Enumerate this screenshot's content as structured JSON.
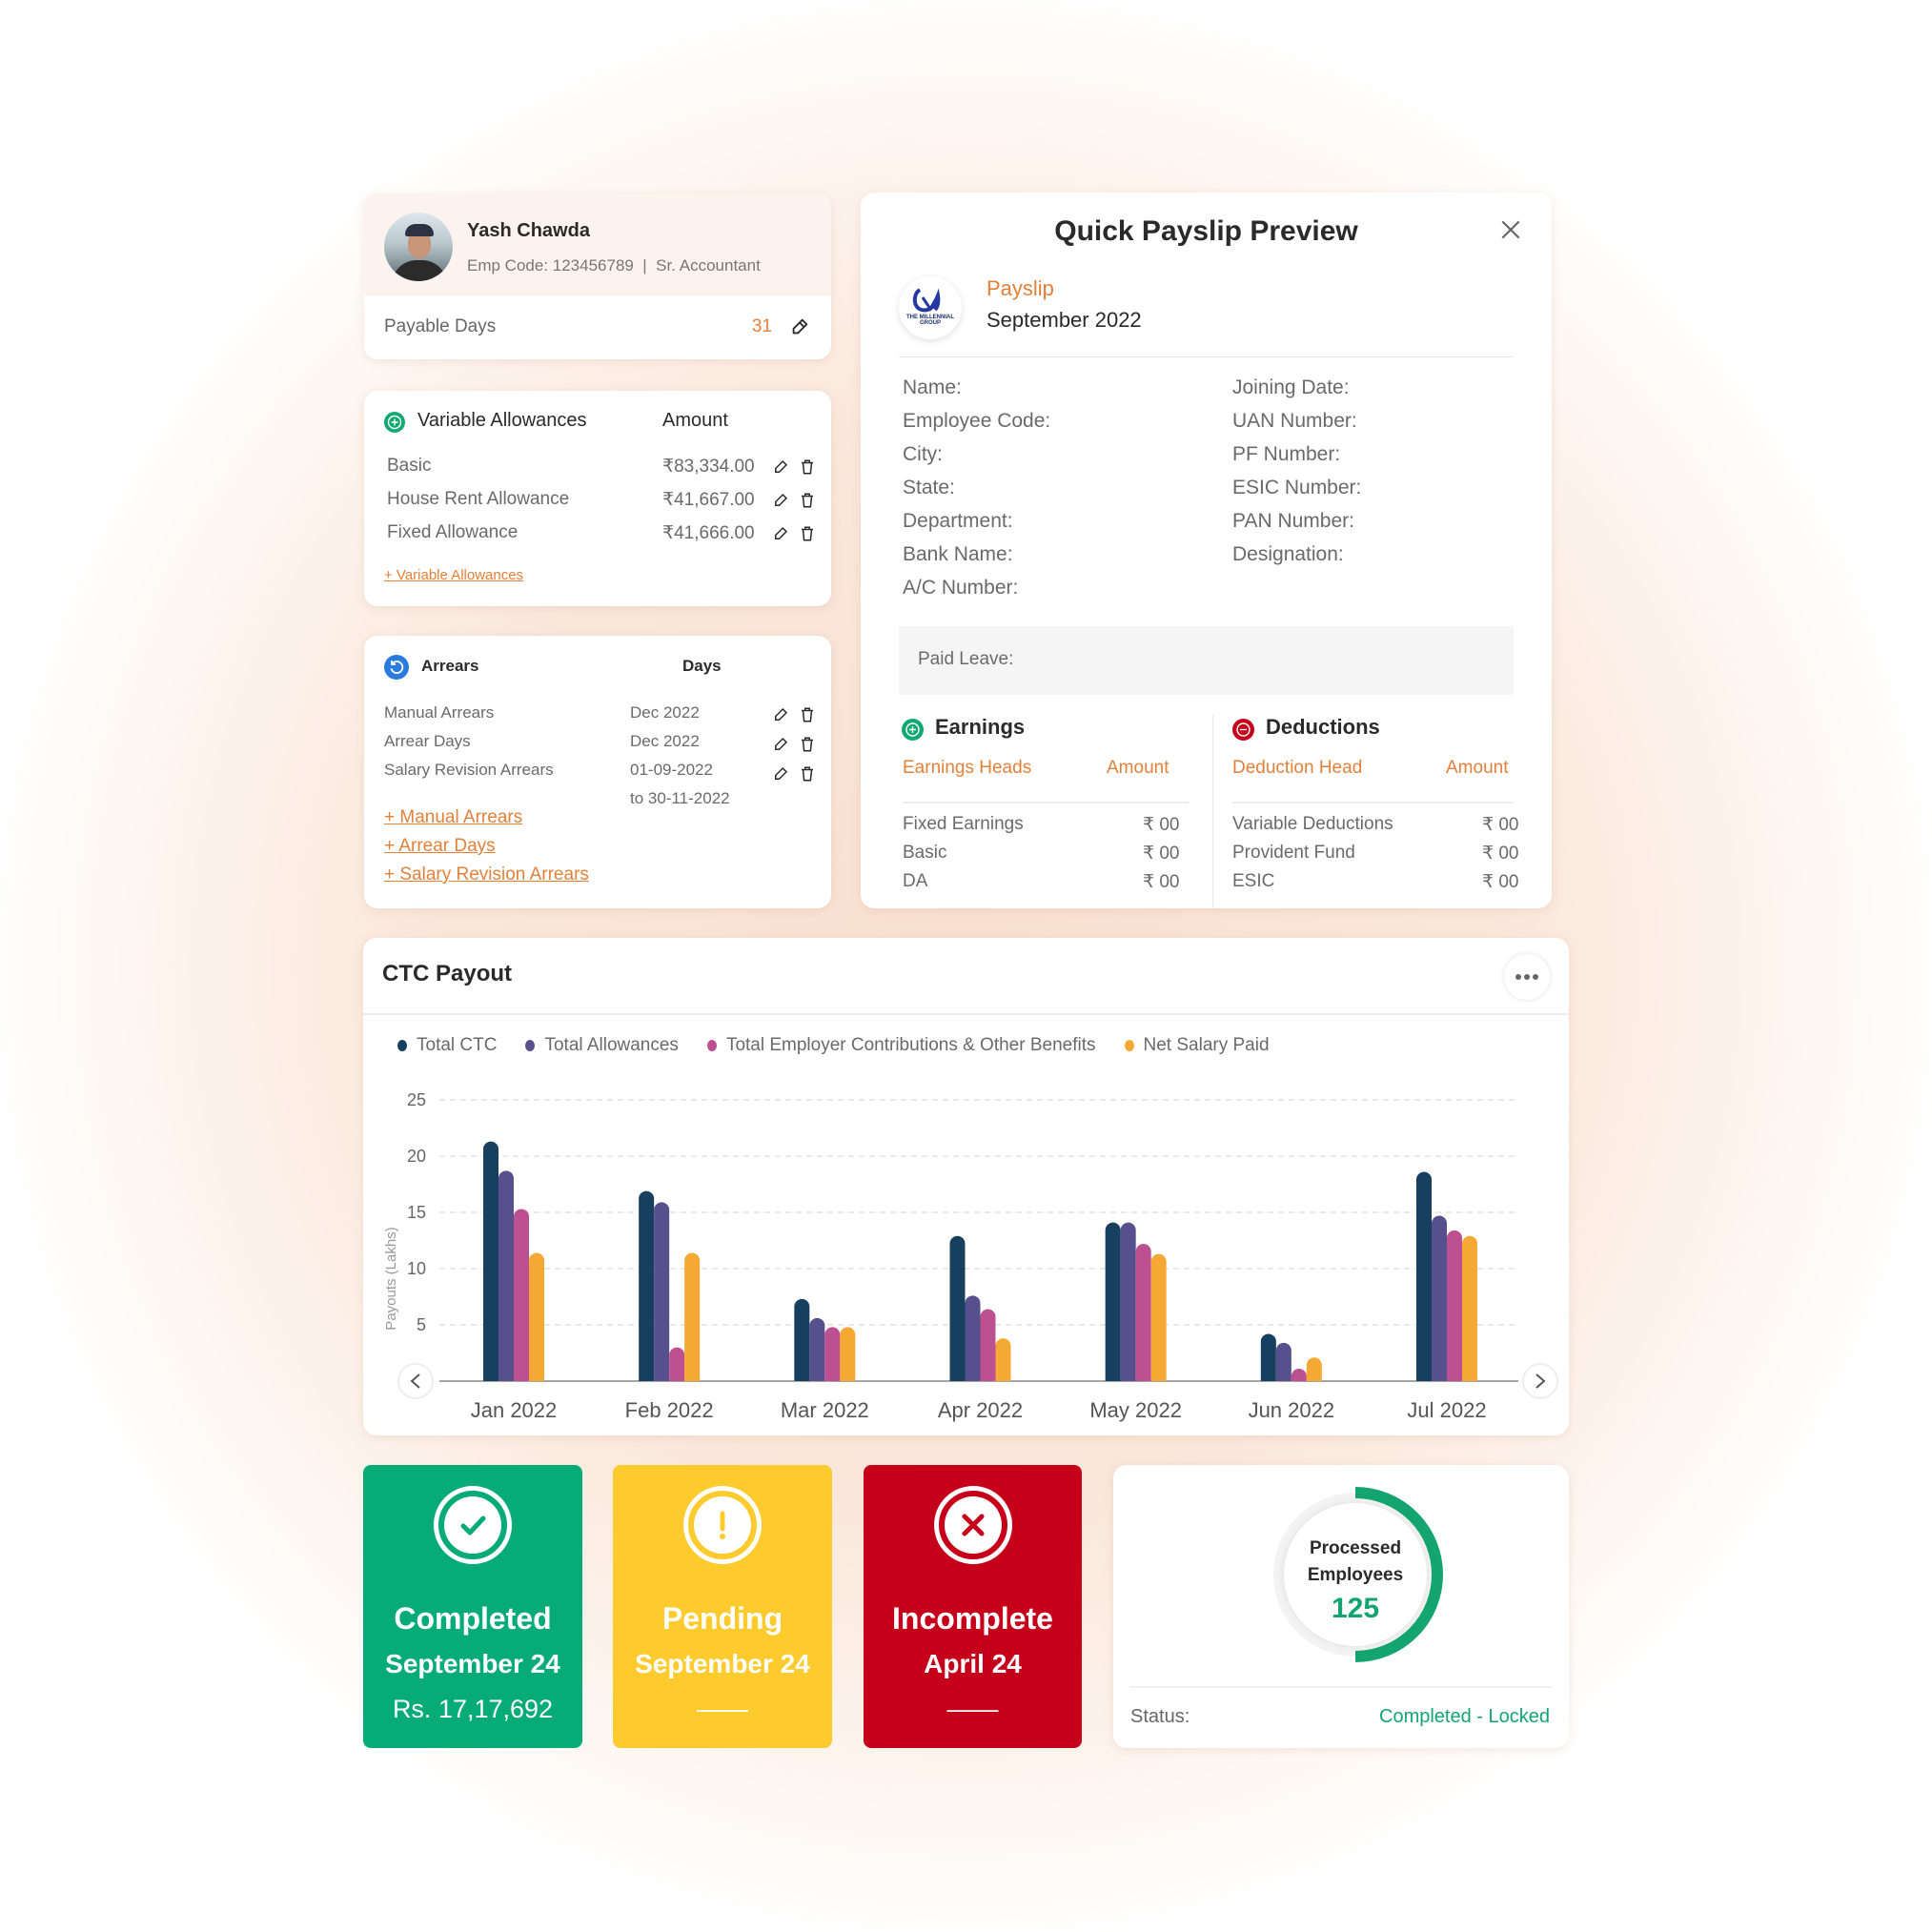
{
  "profile": {
    "name": "Yash Chawda",
    "emp_code_line": "Emp Code: 123456789  |  Sr. Accountant",
    "payable_days_label": "Payable Days",
    "payable_days_value": "31",
    "avatar_icon": "user-photo",
    "edit_icon": "pencil-icon"
  },
  "variable_allowances": {
    "title": "Variable Allowances",
    "amount_header": "Amount",
    "rows": [
      {
        "label": "Basic",
        "amount": "₹83,334.00"
      },
      {
        "label": "House Rent Allowance",
        "amount": "₹41,667.00"
      },
      {
        "label": "Fixed Allowance",
        "amount": "₹41,666.00"
      }
    ],
    "add_link": "+ Variable Allowances"
  },
  "arrears": {
    "title": "Arrears",
    "days_header": "Days",
    "rows": [
      {
        "label": "Manual Arrears",
        "days": "Dec 2022",
        "days2": ""
      },
      {
        "label": "Arrear Days",
        "days": "Dec 2022",
        "days2": ""
      },
      {
        "label": "Salary Revision Arrears",
        "days": "01-09-2022",
        "days2": "to 30-11-2022"
      }
    ],
    "add_links": [
      "+ Manual Arrears",
      "+ Arrear Days",
      "+ Salary Revision Arrears"
    ]
  },
  "payslip": {
    "title": "Quick Payslip Preview",
    "label": "Payslip",
    "month": "September 2022",
    "logo_text": "THE MILLENNIAL GROUP",
    "left_fields": [
      "Name:",
      "Employee Code:",
      "City:",
      "State:",
      "Department:",
      "Bank Name:",
      "A/C Number:"
    ],
    "right_fields": [
      "Joining Date:",
      "UAN Number:",
      "PF Number:",
      "ESIC Number:",
      "PAN Number:",
      "Designation:"
    ],
    "paid_leave_label": "Paid Leave:",
    "earnings": {
      "title": "Earnings",
      "head_col": "Earnings Heads",
      "amount_col": "Amount",
      "rows": [
        {
          "label": "Fixed Earnings",
          "amount": "₹ 00"
        },
        {
          "label": "Basic",
          "amount": "₹ 00"
        },
        {
          "label": "DA",
          "amount": "₹ 00"
        }
      ]
    },
    "deductions": {
      "title": "Deductions",
      "head_col": "Deduction Head",
      "amount_col": "Amount",
      "rows": [
        {
          "label": "Variable Deductions",
          "amount": "₹ 00"
        },
        {
          "label": "Provident Fund",
          "amount": "₹ 00"
        },
        {
          "label": "ESIC",
          "amount": "₹ 00"
        }
      ]
    }
  },
  "ctc_card": {
    "title": "CTC Payout",
    "more_icon": "ellipsis-icon"
  },
  "chart_data": {
    "type": "bar",
    "title": "CTC Payout",
    "xlabel": "",
    "ylabel": "Payouts (Lakhs)",
    "ylim": [
      0,
      25
    ],
    "yticks": [
      5,
      10,
      15,
      20,
      25
    ],
    "grid": true,
    "legend_position": "top-left",
    "categories": [
      "Jan 2022",
      "Feb 2022",
      "Mar 2022",
      "Apr 2022",
      "May 2022",
      "Jun 2022",
      "Jul 2022"
    ],
    "series": [
      {
        "name": "Total CTC",
        "color": "#173f5f",
        "values": [
          21.3,
          16.9,
          7.3,
          12.9,
          14.1,
          4.2,
          18.6
        ]
      },
      {
        "name": "Total Allowances",
        "color": "#58508d",
        "values": [
          18.7,
          15.9,
          5.6,
          7.6,
          14.1,
          3.4,
          14.7
        ]
      },
      {
        "name": "Total Employer Contributions & Other Benefits",
        "color": "#bc5090",
        "values": [
          15.3,
          3.0,
          4.8,
          6.4,
          12.2,
          1.1,
          13.4
        ]
      },
      {
        "name": "Net Salary Paid",
        "color": "#f5a833",
        "values": [
          11.4,
          11.4,
          4.8,
          3.8,
          11.3,
          2.1,
          12.9
        ]
      }
    ]
  },
  "status_cards": [
    {
      "status": "Completed",
      "period": "September 24",
      "detail": "Rs. 17,17,692",
      "color": "#06ab76",
      "icon": "check-circle-icon"
    },
    {
      "status": "Pending",
      "period": "September 24",
      "detail": "——",
      "color": "#fecb2f",
      "icon": "exclamation-circle-icon"
    },
    {
      "status": "Incomplete",
      "period": "April 24",
      "detail": "——",
      "color": "#c6001a",
      "icon": "x-circle-icon"
    }
  ],
  "processed": {
    "label_line1": "Processed",
    "label_line2": "Employees",
    "count": "125",
    "progress_fraction": 0.5,
    "status_label": "Status:",
    "status_value": "Completed - Locked",
    "accent": "#13a472"
  }
}
